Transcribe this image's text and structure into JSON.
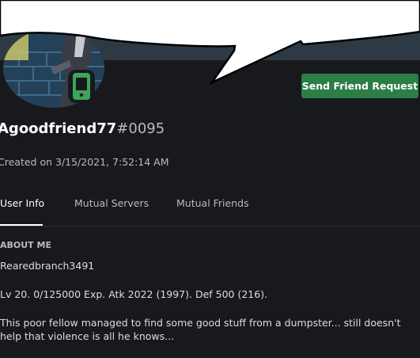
{
  "profile": {
    "username": "Agoodfriend77",
    "discriminator": "#0095",
    "created": "Created on 3/15/2021, 7:52:14 AM",
    "status": "mobile-online",
    "friend_button": "Send Friend Request"
  },
  "tabs": [
    {
      "label": "User Info",
      "active": true
    },
    {
      "label": "Mutual Servers",
      "active": false
    },
    {
      "label": "Mutual Friends",
      "active": false
    }
  ],
  "about": {
    "header": "ABOUT ME",
    "lines": [
      "Rearedbranch3491",
      "Lv 20. 0/125000 Exp. Atk 2022 (1997). Def 500 (216)."
    ],
    "bio": "This poor fellow managed to find some good stuff from a dumpster... still doesn't help that violence is all he knows..."
  },
  "colors": {
    "background": "#18191c",
    "button": "#2d7d46",
    "status_green": "#3ba55c",
    "banner": "#2d3a44"
  },
  "icons": [
    "mobile-status-icon"
  ]
}
